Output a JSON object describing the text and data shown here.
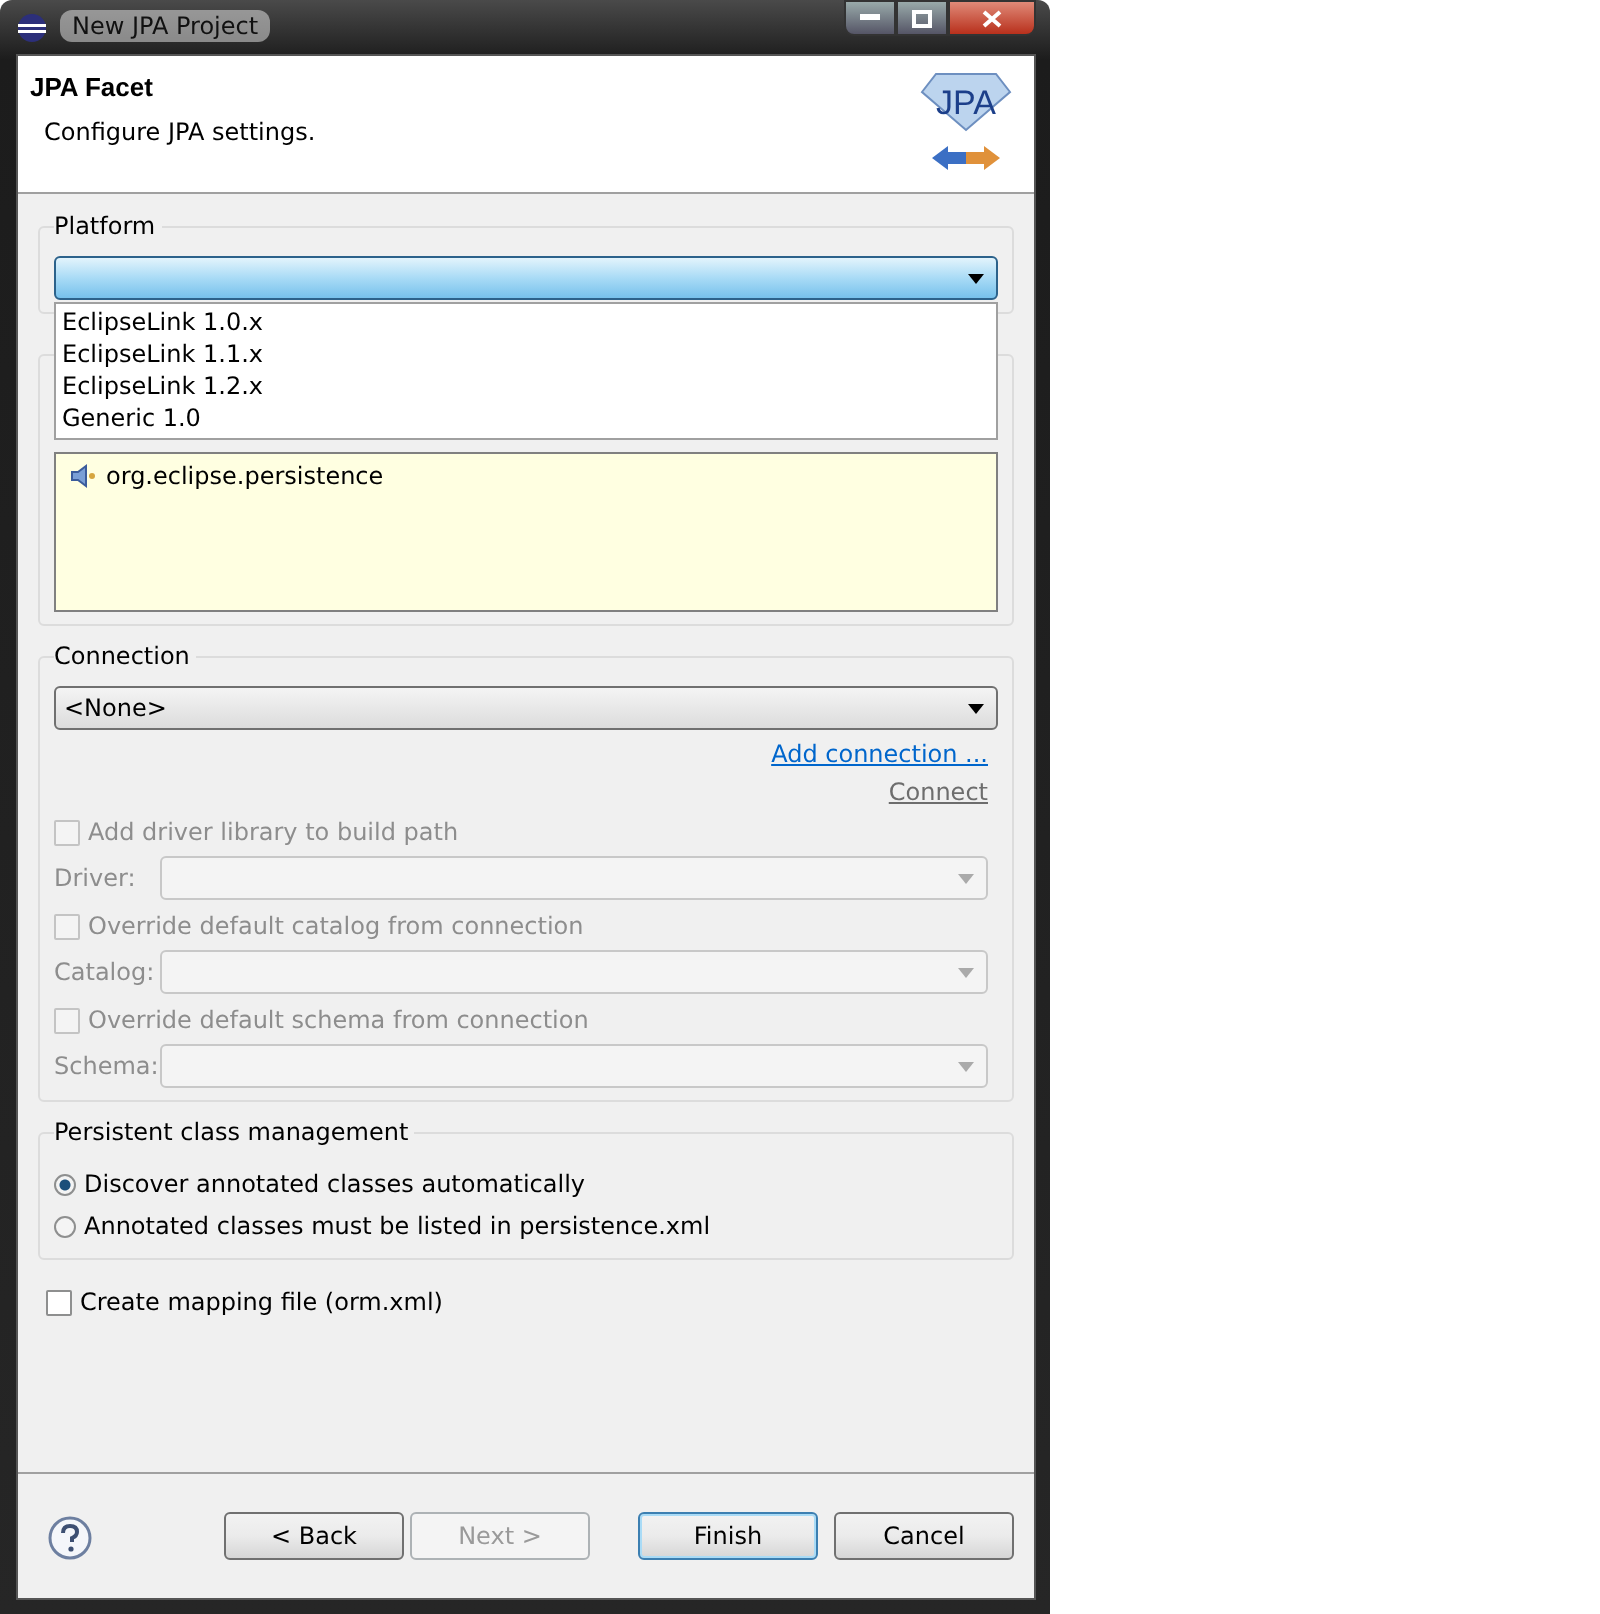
{
  "window": {
    "title": "New JPA Project"
  },
  "header": {
    "title": "JPA Facet",
    "description": "Configure JPA settings.",
    "logo_text": "JPA"
  },
  "platform": {
    "label": "Platform",
    "expanded": true,
    "options": [
      {
        "label": "EclipseLink 1.0.x",
        "selected": false
      },
      {
        "label": "EclipseLink 1.1.x",
        "selected": false
      },
      {
        "label": "EclipseLink 1.2.x",
        "selected": false
      },
      {
        "label": "Generic 1.0",
        "selected": false
      }
    ]
  },
  "libraries": {
    "items": [
      "org.eclipse.persistence"
    ]
  },
  "connection": {
    "label": "Connection",
    "value": "<None>",
    "add_link": "Add connection ...",
    "connect": {
      "label": "Connect",
      "disabled": true
    },
    "rows": [
      {
        "kind": "checkbox",
        "label": "Add driver library to build path",
        "checked": false,
        "disabled": true
      },
      {
        "kind": "combo",
        "label": "Driver:",
        "disabled": true
      },
      {
        "kind": "checkbox",
        "label": "Override default catalog from connection",
        "checked": false,
        "disabled": true
      },
      {
        "kind": "combo",
        "label": "Catalog:",
        "disabled": true
      },
      {
        "kind": "checkbox",
        "label": "Override default schema from connection",
        "checked": false,
        "disabled": true
      },
      {
        "kind": "combo",
        "label": "Schema:",
        "disabled": true
      }
    ]
  },
  "persistent_class_management": {
    "label": "Persistent class management",
    "options": [
      {
        "label": "Discover annotated classes automatically",
        "selected": true
      },
      {
        "label": "Annotated classes must be listed in persistence.xml",
        "selected": false
      }
    ]
  },
  "mapping_file": {
    "label": "Create mapping file (orm.xml)",
    "checked": false
  },
  "buttons": [
    {
      "label": "< Back",
      "disabled": false,
      "default": false
    },
    {
      "label": "Next >",
      "disabled": true,
      "default": false
    },
    {
      "label": "Finish",
      "disabled": false,
      "default": true
    },
    {
      "label": "Cancel",
      "disabled": false,
      "default": false
    }
  ]
}
